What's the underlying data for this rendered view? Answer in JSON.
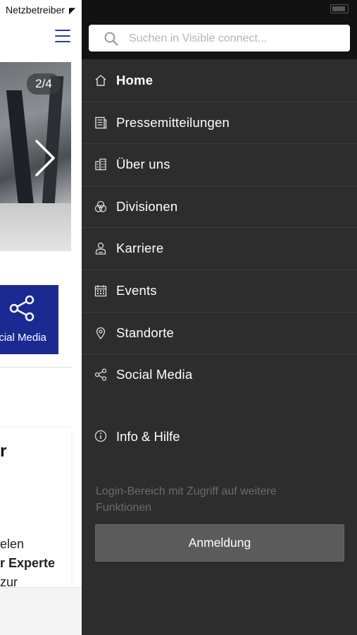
{
  "status_bar": {
    "carrier": "Netzbetreiber"
  },
  "page": {
    "carousel": {
      "indicator": "2/4"
    },
    "social_tile": {
      "label": "Social Media"
    },
    "card": {
      "heading": "r",
      "lines": [
        "elen",
        "r Experte",
        "zur"
      ]
    }
  },
  "drawer": {
    "search": {
      "placeholder": "Suchen in Visible connect..."
    },
    "menu": [
      {
        "label": "Home",
        "icon": "home-icon",
        "active": true
      },
      {
        "label": "Pressemitteilungen",
        "icon": "newspaper-icon"
      },
      {
        "label": "Über uns",
        "icon": "building-icon"
      },
      {
        "label": "Divisionen",
        "icon": "divisions-icon"
      },
      {
        "label": "Karriere",
        "icon": "person-icon"
      },
      {
        "label": "Events",
        "icon": "calendar-icon"
      },
      {
        "label": "Standorte",
        "icon": "location-pin-icon"
      },
      {
        "label": "Social Media",
        "icon": "share-icon"
      }
    ],
    "info": {
      "label": "Info & Hilfe",
      "icon": "info-icon"
    },
    "login": {
      "text": "Login-Bereich mit Zugriff auf weitere Funktionen",
      "button_label": "Anmeldung"
    }
  },
  "colors": {
    "drawer_bg": "#2d2d2d",
    "drawer_header": "#121212",
    "brand_blue": "#1b2a92",
    "button_bg": "#5b5b5b"
  }
}
